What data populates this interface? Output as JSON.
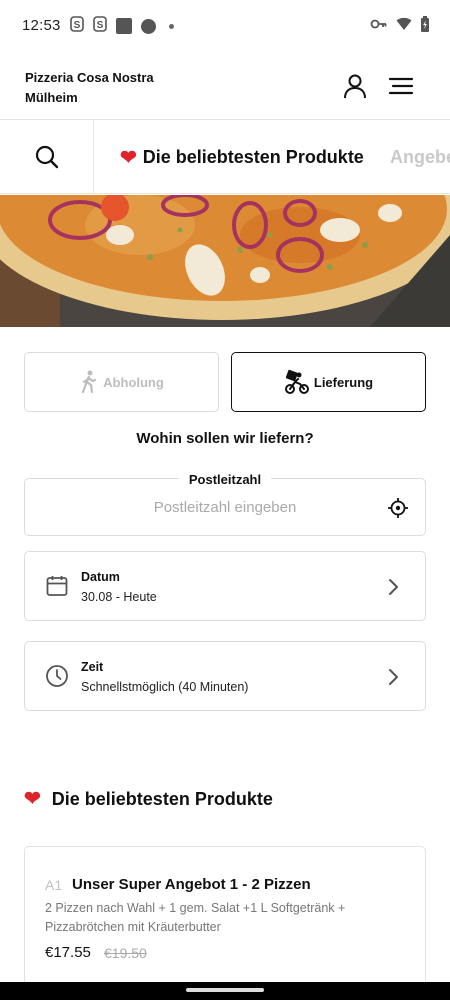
{
  "status_bar": {
    "time": "12:53",
    "left_icons": [
      "s-notification-icon",
      "s-notification-icon",
      "square-icon",
      "circle-app-icon",
      "dot-icon"
    ],
    "right_icons": [
      "vpn-key-icon",
      "wifi-icon",
      "battery-icon"
    ]
  },
  "header": {
    "store_line1": "Pizzeria Cosa Nostra",
    "store_line2": "Mülheim"
  },
  "tabs": {
    "active": "Die beliebtesten Produkte",
    "next": "Angebe"
  },
  "order_mode": {
    "pickup_label": "Abholung",
    "delivery_label": "Lieferung",
    "selected": "delivery"
  },
  "delivery": {
    "question": "Wohin sollen wir liefern?",
    "postcode_label": "Postleitzahl",
    "postcode_placeholder": "Postleitzahl eingeben",
    "postcode_value": ""
  },
  "date": {
    "title": "Datum",
    "value": "30.08 - Heute"
  },
  "time": {
    "title": "Zeit",
    "value": "Schnellstmöglich (40 Minuten)"
  },
  "popular": {
    "heading": "Die beliebtesten Produkte"
  },
  "product": {
    "code": "A1",
    "name": "Unser Super Angebot 1 - 2 Pizzen",
    "description": "2 Pizzen nach Wahl + 1 gem. Salat +1 L Softgetränk + Pizzabrötchen mit Kräuterbutter",
    "price": "€17.55",
    "old_price": "€19.50"
  },
  "colors": {
    "heart": "#e0242b",
    "text": "#111111",
    "muted": "#aaaaaa",
    "border": "#dcdcdc"
  }
}
